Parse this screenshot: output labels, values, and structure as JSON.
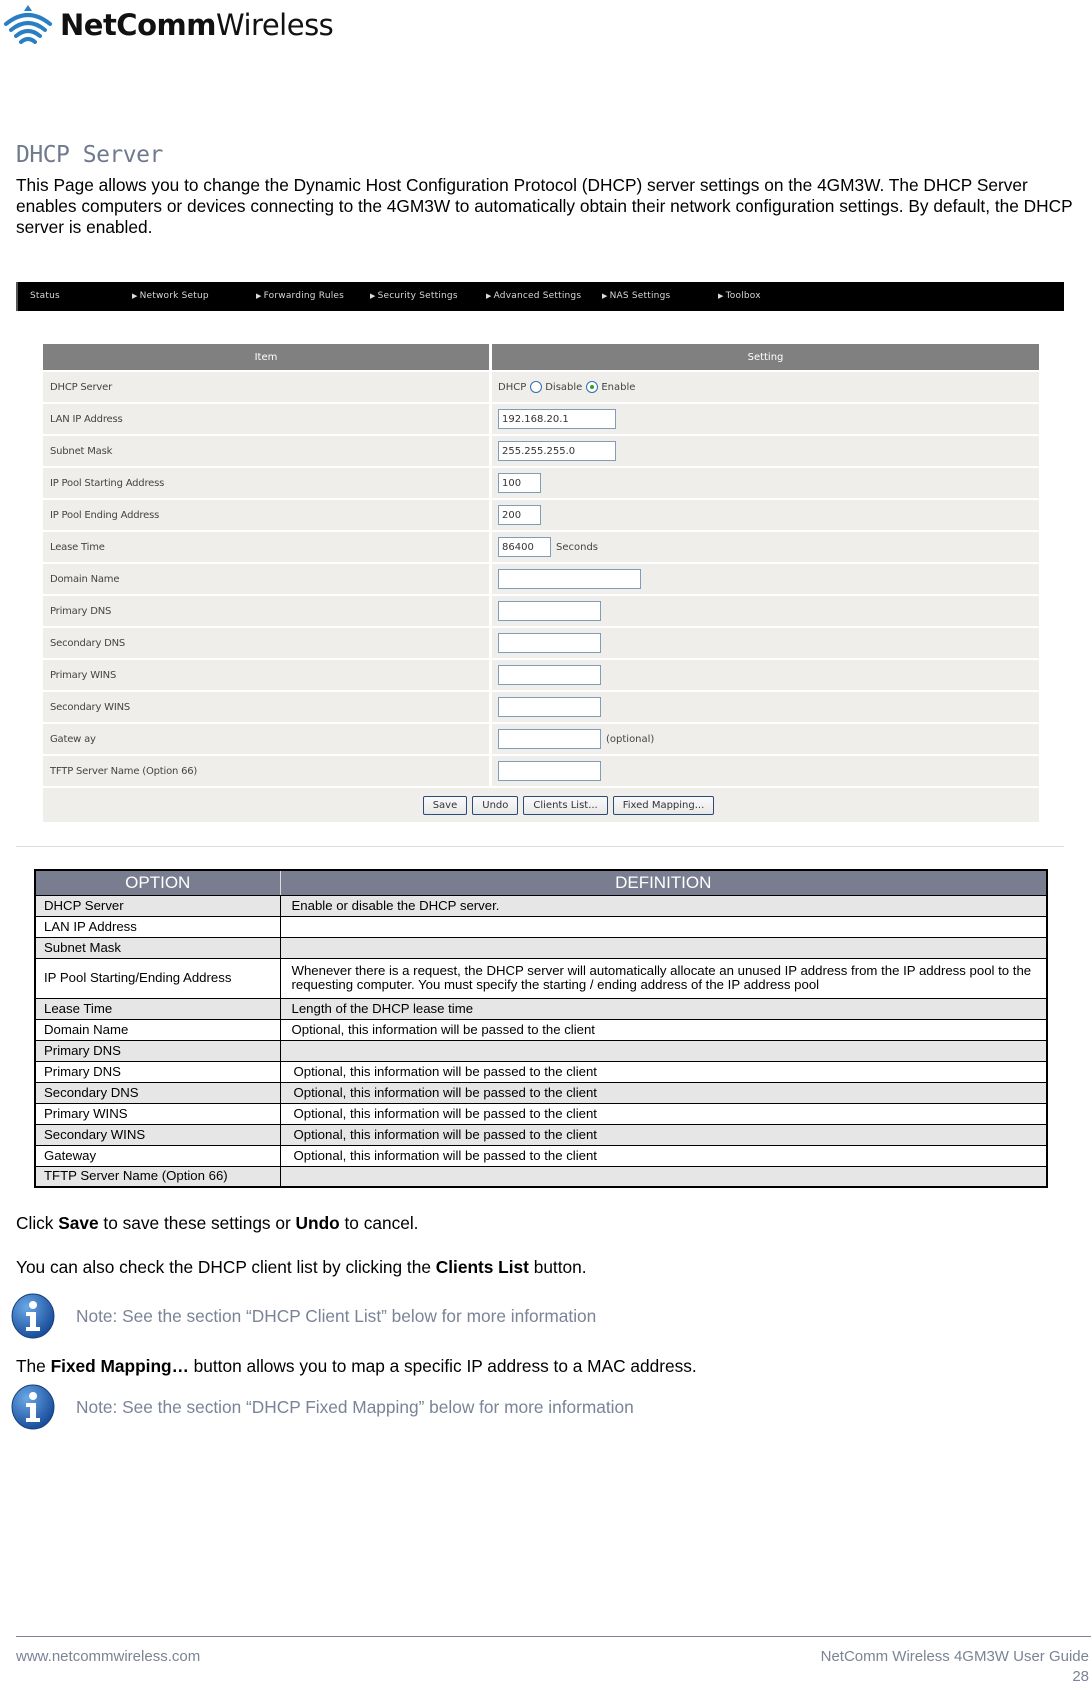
{
  "logo": {
    "brand_bold": "NetComm",
    "brand_light": "Wireless"
  },
  "section": {
    "title": "DHCP Server",
    "intro": "This Page allows you to change the Dynamic Host Configuration Protocol (DHCP) server settings on the 4GM3W. The DHCP Server enables computers or devices connecting to the 4GM3W to automatically obtain their network configuration settings. By default, the DHCP server is enabled."
  },
  "router_ui": {
    "nav": [
      {
        "label": "Status",
        "arrow": false
      },
      {
        "label": "Network Setup",
        "arrow": true
      },
      {
        "label": "Forwarding Rules",
        "arrow": true
      },
      {
        "label": "Security Settings",
        "arrow": true
      },
      {
        "label": "Advanced Settings",
        "arrow": true
      },
      {
        "label": "NAS Settings",
        "arrow": true
      },
      {
        "label": "Toolbox",
        "arrow": true
      }
    ],
    "headers": {
      "item": "Item",
      "setting": "Setting"
    },
    "rows": {
      "dhcp_server": {
        "label": "DHCP Server",
        "prefix": "DHCP",
        "option_disable": "Disable",
        "option_enable": "Enable",
        "selected": "Enable"
      },
      "lan_ip": {
        "label": "LAN IP Address",
        "value": "192.168.20.1"
      },
      "subnet": {
        "label": "Subnet Mask",
        "value": "255.255.255.0"
      },
      "pool_start": {
        "label": "IP Pool Starting Address",
        "value": "100"
      },
      "pool_end": {
        "label": "IP Pool Ending Address",
        "value": "200"
      },
      "lease": {
        "label": "Lease Time",
        "value": "86400",
        "suffix": "Seconds"
      },
      "domain": {
        "label": "Domain Name",
        "value": ""
      },
      "primary_dns": {
        "label": "Primary DNS",
        "value": ""
      },
      "secondary_dns": {
        "label": "Secondary DNS",
        "value": ""
      },
      "primary_wins": {
        "label": "Primary WINS",
        "value": ""
      },
      "secondary_wins": {
        "label": "Secondary WINS",
        "value": ""
      },
      "gateway": {
        "label": "Gatew ay",
        "value": "",
        "suffix": "(optional)"
      },
      "tftp": {
        "label": "TFTP Server Name (Option 66)",
        "value": ""
      }
    },
    "buttons": {
      "save": "Save",
      "undo": "Undo",
      "clients": "Clients List...",
      "fixed": "Fixed Mapping..."
    }
  },
  "option_table": {
    "headers": {
      "option": "OPTION",
      "definition": "DEFINITION"
    },
    "rows": [
      {
        "option": "DHCP Server",
        "definition": "Enable or disable the DHCP server."
      },
      {
        "option": "LAN IP Address",
        "definition": ""
      },
      {
        "option": "Subnet Mask",
        "definition": ""
      },
      {
        "option": "IP Pool Starting/Ending Address",
        "definition": "Whenever there is a request, the DHCP server will automatically allocate an unused IP address from the IP address pool to the requesting computer. You must specify the starting / ending address of the IP address pool"
      },
      {
        "option": "Lease Time",
        "definition": "Length of the DHCP lease time"
      },
      {
        "option": "Domain Name",
        "definition": "Optional, this information will be passed to the client"
      },
      {
        "option": "Primary DNS",
        "definition": ""
      },
      {
        "option": "Primary DNS",
        "definition": "Optional, this information will be passed to the client"
      },
      {
        "option": "Secondary DNS",
        "definition": "Optional, this information will be passed to the client"
      },
      {
        "option": "Primary WINS",
        "definition": "Optional, this information will be passed to the client"
      },
      {
        "option": "Secondary WINS",
        "definition": "Optional, this information will be passed to the client"
      },
      {
        "option": "Gateway",
        "definition": "Optional, this information will be passed to the client"
      },
      {
        "option": "TFTP Server Name (Option 66)",
        "definition": ""
      }
    ]
  },
  "body": {
    "p1": {
      "a": "Click ",
      "b1": "Save",
      "c": " to save these settings or ",
      "b2": "Undo",
      "d": " to cancel."
    },
    "p2": {
      "a": "You can also check the DHCP client list by clicking the ",
      "b": "Clients List",
      "c": " button."
    },
    "note1": "Note: See the section “DHCP Client List” below for more information",
    "p3": {
      "a": "The ",
      "b": "Fixed Mapping…",
      "c": " button allows you to map a specific IP address to a MAC address."
    },
    "note2": "Note: See the section “DHCP Fixed Mapping” below for more information"
  },
  "footer": {
    "website": "www.netcommwireless.com",
    "guide": "NetComm Wireless 4GM3W User Guide",
    "page": "28"
  }
}
